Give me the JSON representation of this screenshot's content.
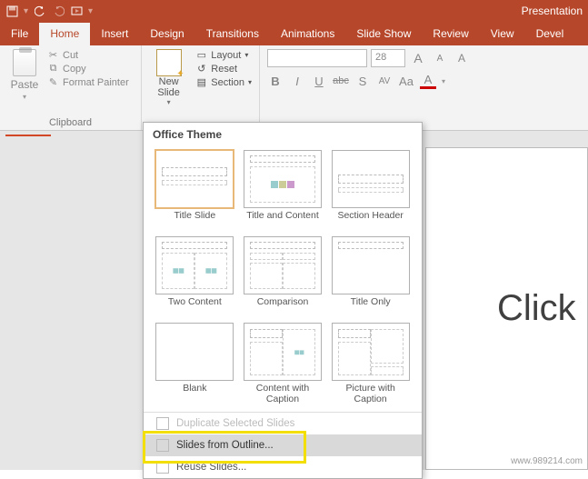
{
  "title": "Presentation",
  "tabs": [
    "File",
    "Home",
    "Insert",
    "Design",
    "Transitions",
    "Animations",
    "Slide Show",
    "Review",
    "View",
    "Devel"
  ],
  "active_tab": "Home",
  "clipboard": {
    "paste": "Paste",
    "cut": "Cut",
    "copy": "Copy",
    "format_painter": "Format Painter",
    "group_label": "Clipboard"
  },
  "slides_group": {
    "new_slide": "New\nSlide",
    "layout": "Layout",
    "reset": "Reset",
    "section": "Section"
  },
  "font": {
    "name_placeholder": "",
    "size": "28",
    "buttons": {
      "grow": "A",
      "shrink": "A",
      "clear": "A"
    },
    "bold": "B",
    "italic": "I",
    "underline": "U",
    "strike": "abc",
    "shadow": "S",
    "spacing": "AV",
    "case": "Aa",
    "color": "A"
  },
  "dropdown": {
    "title": "Office Theme",
    "layouts": [
      {
        "name": "Title Slide",
        "thumb": "title"
      },
      {
        "name": "Title and Content",
        "thumb": "title-content"
      },
      {
        "name": "Section Header",
        "thumb": "section"
      },
      {
        "name": "Two Content",
        "thumb": "two"
      },
      {
        "name": "Comparison",
        "thumb": "compare"
      },
      {
        "name": "Title Only",
        "thumb": "titleonly"
      },
      {
        "name": "Blank",
        "thumb": "blank"
      },
      {
        "name": "Content with Caption",
        "thumb": "content-cap"
      },
      {
        "name": "Picture with Caption",
        "thumb": "pic-cap"
      }
    ],
    "items": {
      "duplicate": "Duplicate Selected Slides",
      "outline": "Slides from Outline...",
      "reuse": "Reuse Slides..."
    }
  },
  "slide_text": "Click",
  "watermark": "www.989214.com"
}
